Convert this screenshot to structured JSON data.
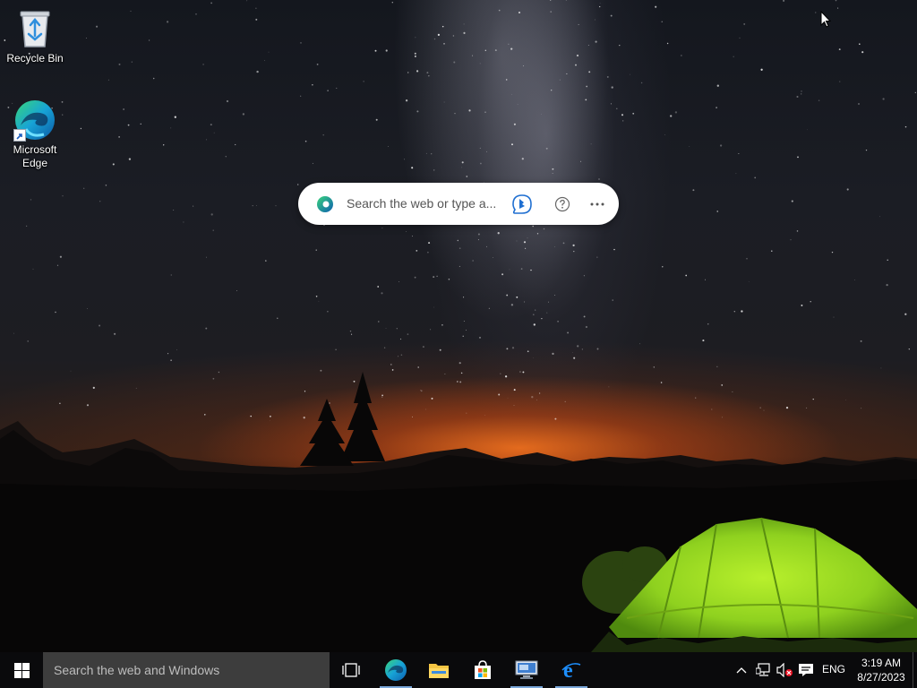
{
  "desktop": {
    "icons": [
      {
        "label": "Recycle Bin",
        "icon": "recycle-bin-icon"
      },
      {
        "label": "Microsoft Edge",
        "icon": "edge-icon"
      }
    ]
  },
  "edge_search_widget": {
    "placeholder": "Search the web or type a...",
    "buttons": [
      "bing-chat-icon",
      "help-icon",
      "more-options-icon"
    ]
  },
  "taskbar": {
    "start_icon": "windows-logo-icon",
    "search_placeholder": "Search the web and Windows",
    "apps": [
      {
        "name": "Task View",
        "icon": "task-view-icon",
        "running": false
      },
      {
        "name": "Microsoft Edge",
        "icon": "edge-icon",
        "running": true
      },
      {
        "name": "File Explorer",
        "icon": "folder-icon",
        "running": false
      },
      {
        "name": "Microsoft Store",
        "icon": "store-icon",
        "running": false
      },
      {
        "name": "Remote Desktop",
        "icon": "remote-desktop-icon",
        "running": true
      },
      {
        "name": "Internet Explorer",
        "icon": "ie-icon",
        "running": true
      }
    ],
    "tray": {
      "icons": [
        "chevron-up-icon",
        "network-icon",
        "volume-muted-icon",
        "action-center-icon"
      ],
      "language": "ENG",
      "time": "3:19 AM",
      "date": "8/27/2023"
    }
  },
  "colors": {
    "taskbar": "#0a0a0c",
    "search_box": "#3d3d3d",
    "accent": "#7aa7d9",
    "tent": "#8fd11f"
  }
}
